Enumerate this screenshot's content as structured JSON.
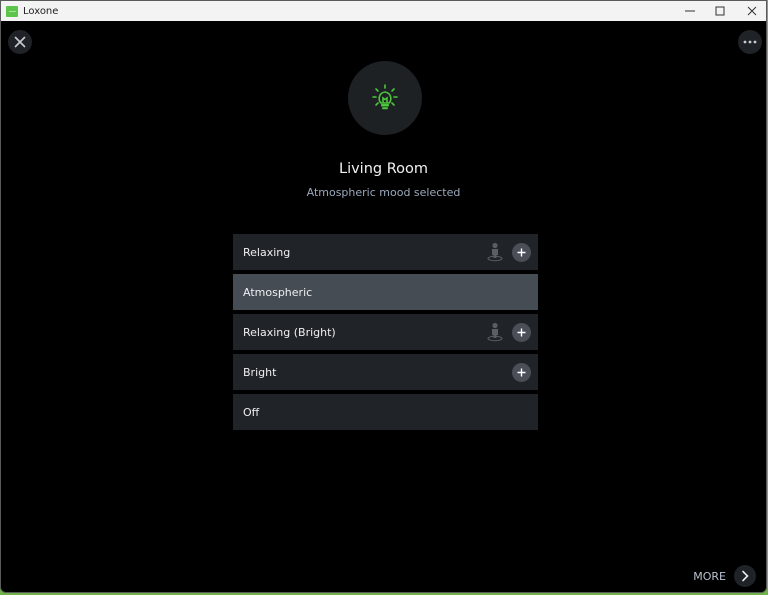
{
  "window": {
    "title": "Loxone",
    "controls": [
      "minimize",
      "maximize",
      "close"
    ]
  },
  "header": {
    "close_icon": "close-icon",
    "more_icon": "ellipsis-icon"
  },
  "room": {
    "icon": "lightbulb-icon",
    "icon_color": "#4cc63a",
    "title": "Living Room",
    "status": "Atmospheric mood selected"
  },
  "moods": [
    {
      "label": "Relaxing",
      "selected": false,
      "has_person_icon": true,
      "has_add": true
    },
    {
      "label": "Atmospheric",
      "selected": true,
      "has_person_icon": false,
      "has_add": false
    },
    {
      "label": "Relaxing (Bright)",
      "selected": false,
      "has_person_icon": true,
      "has_add": true
    },
    {
      "label": "Bright",
      "selected": false,
      "has_person_icon": false,
      "has_add": true
    },
    {
      "label": "Off",
      "selected": false,
      "has_person_icon": false,
      "has_add": false
    }
  ],
  "footer": {
    "more_label": "MORE",
    "more_icon": "chevron-right-icon"
  }
}
